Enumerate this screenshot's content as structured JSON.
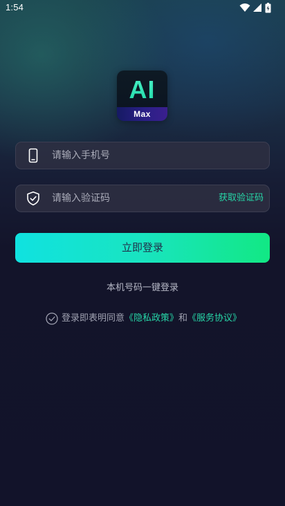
{
  "status_bar": {
    "time": "1:54",
    "icons": [
      "wifi-icon",
      "signal-icon",
      "battery-icon"
    ]
  },
  "logo": {
    "title": "AI",
    "subtitle": "Max"
  },
  "login_form": {
    "phone_placeholder": "请输入手机号",
    "phone_value": "",
    "code_placeholder": "请输入验证码",
    "code_value": "",
    "get_code_label": "获取验证码",
    "submit_label": "立即登录",
    "one_click_label": "本机号码一键登录"
  },
  "agreement": {
    "prefix": "登录即表明同意",
    "privacy_link": "《隐私政策》",
    "conjunction": "和",
    "service_link": "《服务协议》",
    "checked": false
  },
  "colors": {
    "accent": "#27d6a7",
    "button_gradient_start": "#10e2e0",
    "button_gradient_end": "#12e884",
    "background": "#13132a"
  }
}
